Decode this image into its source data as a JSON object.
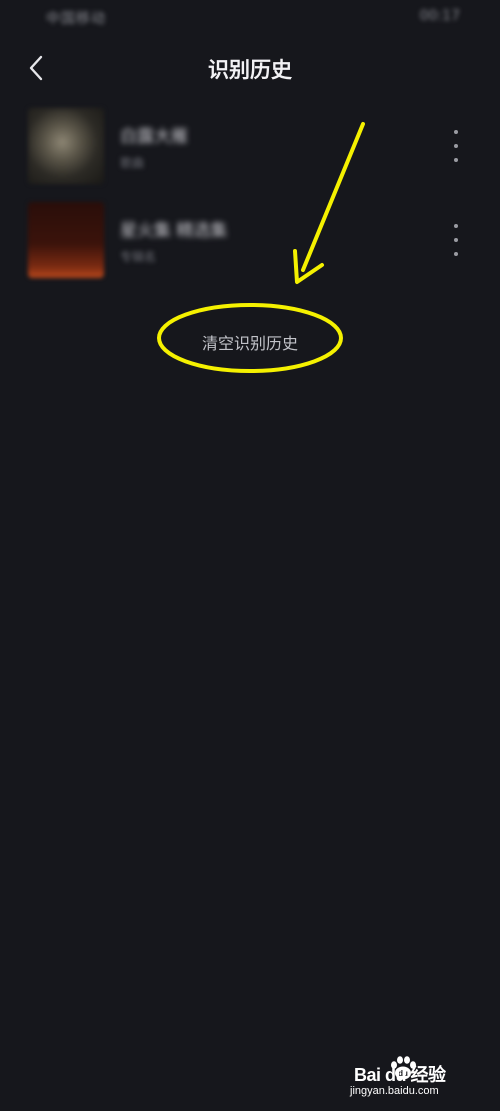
{
  "status_bar": {
    "carrier": "中国移动",
    "right_info": "00:17"
  },
  "nav": {
    "title": "识别历史"
  },
  "history": [
    {
      "title": "白露大雁",
      "subtitle": "歌曲"
    },
    {
      "title": "星火集 精选集",
      "subtitle": "专辑名"
    }
  ],
  "clear_label": "清空识别历史",
  "annotation_color": "#f5f100",
  "watermark": {
    "brand": "Bai du 经验",
    "url": "jingyan.baidu.com"
  }
}
